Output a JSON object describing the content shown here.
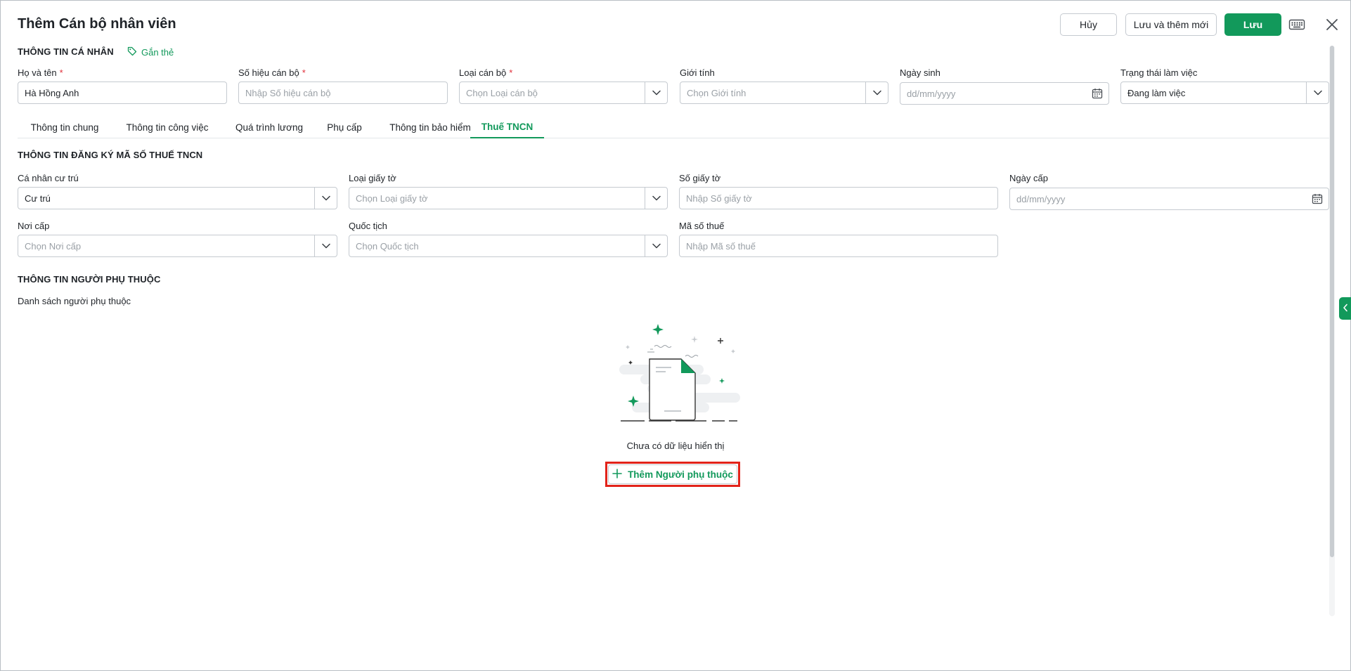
{
  "header": {
    "title": "Thêm Cán bộ nhân viên",
    "cancel_label": "Hủy",
    "save_new_label": "Lưu và thêm mới",
    "save_label": "Lưu"
  },
  "personal": {
    "section_title": "THÔNG TIN CÁ NHÂN",
    "tag_label": "Gắn thẻ",
    "fields": {
      "full_name": {
        "label": "Họ và tên",
        "value": "Hà Hồng Anh",
        "required_mark": "*"
      },
      "staff_code": {
        "label": "Số hiệu cán bộ",
        "placeholder": "Nhập Số hiệu cán bộ",
        "required_mark": "*"
      },
      "staff_type": {
        "label": "Loại cán bộ",
        "placeholder": "Chọn Loại cán bộ",
        "required_mark": "*"
      },
      "gender": {
        "label": "Giới tính",
        "placeholder": "Chọn Giới tính"
      },
      "birth_date": {
        "label": "Ngày sinh",
        "placeholder": "dd/mm/yyyy"
      },
      "work_status": {
        "label": "Trạng thái làm việc",
        "value": "Đang làm việc"
      }
    }
  },
  "tabs": [
    {
      "label": "Thông tin chung"
    },
    {
      "label": "Thông tin công việc"
    },
    {
      "label": "Quá trình lương"
    },
    {
      "label": "Phụ cấp"
    },
    {
      "label": "Thông tin bảo hiểm"
    },
    {
      "label": "Thuế TNCN",
      "active": true
    }
  ],
  "tax": {
    "section_title": "THÔNG TIN ĐĂNG KÝ MÃ SỐ THUẾ TNCN",
    "fields": {
      "residency": {
        "label": "Cá nhân cư trú",
        "value": "Cư trú"
      },
      "doc_type": {
        "label": "Loại giấy tờ",
        "placeholder": "Chọn Loại giấy tờ"
      },
      "doc_number": {
        "label": "Số giấy tờ",
        "placeholder": "Nhập Số giấy tờ"
      },
      "issue_date": {
        "label": "Ngày cấp",
        "placeholder": "dd/mm/yyyy"
      },
      "issue_place": {
        "label": "Nơi cấp",
        "placeholder": "Chọn Nơi cấp"
      },
      "nationality": {
        "label": "Quốc tịch",
        "placeholder": "Chọn Quốc tịch"
      },
      "tax_code": {
        "label": "Mã số thuế",
        "placeholder": "Nhập Mã số thuế"
      }
    }
  },
  "dependents": {
    "section_title": "THÔNG TIN NGƯỜI PHỤ THUỘC",
    "list_label": "Danh sách người phụ thuộc",
    "empty_text": "Chưa có dữ liệu hiển thị",
    "add_label": "Thêm Người phụ thuộc"
  },
  "icons": {
    "keyboard": "keyboard-icon",
    "close": "close-icon",
    "tag": "tag-icon",
    "dropdown": "chevron-down-icon",
    "calendar": "calendar-icon",
    "plus": "plus-icon",
    "side_toggle": "chevron-left-icon"
  },
  "colors": {
    "accent": "#12995b",
    "required": "#e0303a",
    "highlight": "#e2231a"
  }
}
